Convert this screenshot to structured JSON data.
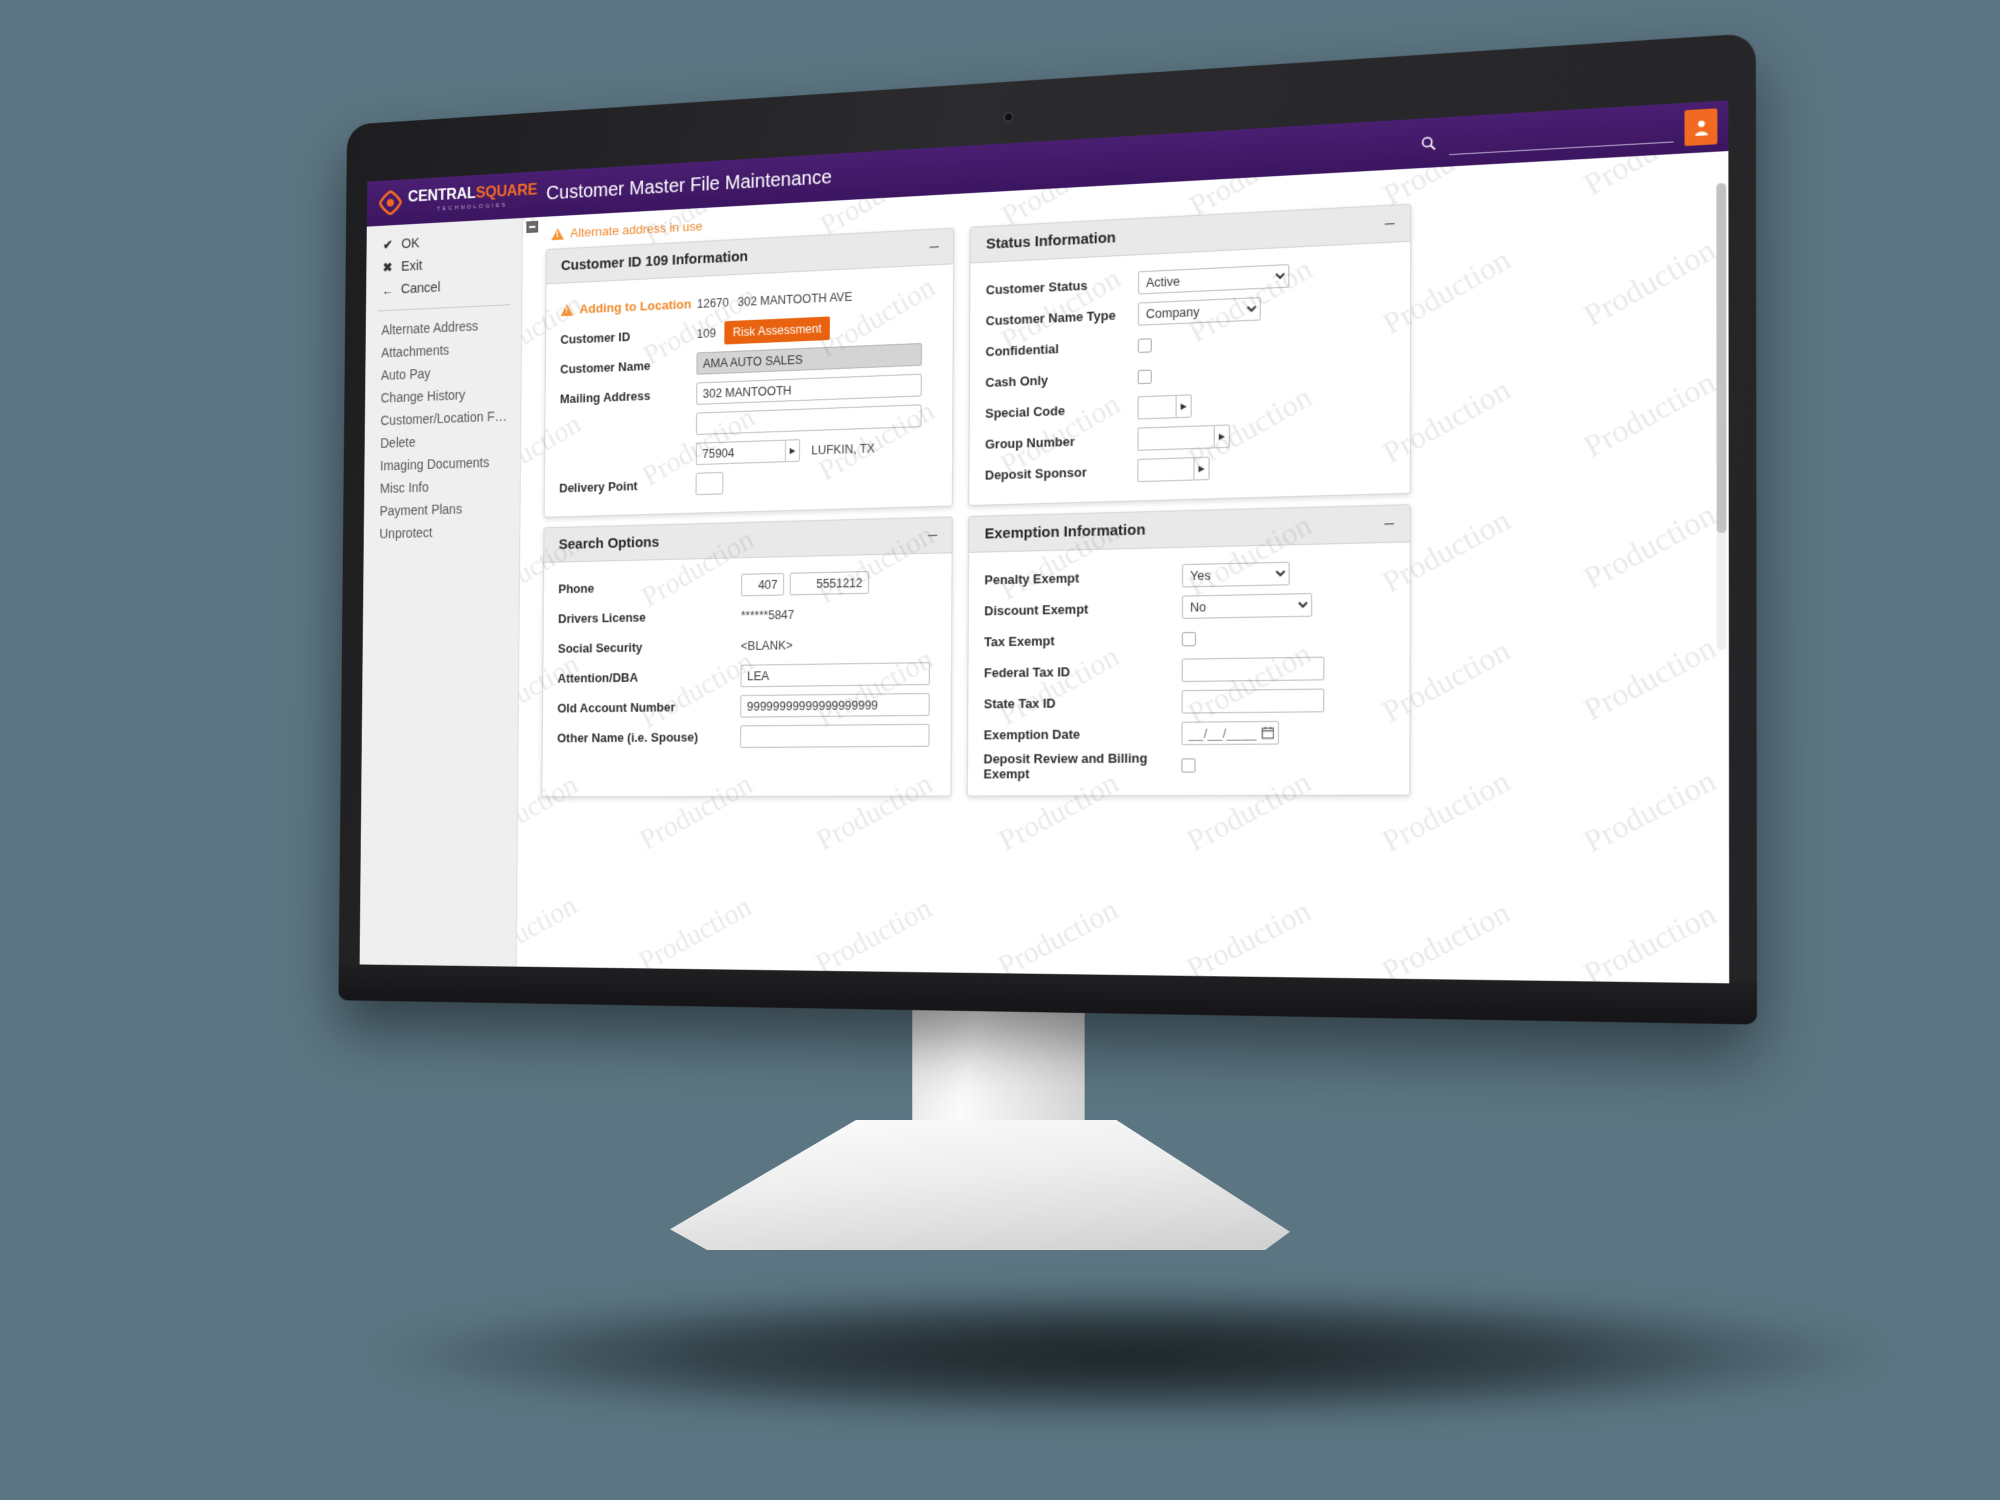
{
  "header": {
    "brand_primary": "CENTRAL",
    "brand_secondary": "SQUARE",
    "brand_tagline": "TECHNOLOGIES",
    "app_title": "Customer Master File Maintenance",
    "search_value": "",
    "search_placeholder": ""
  },
  "sidebar": {
    "actions": [
      {
        "label": "OK",
        "glyph": "✔"
      },
      {
        "label": "Exit",
        "glyph": "✖"
      },
      {
        "label": "Cancel",
        "glyph": "←"
      }
    ],
    "items": [
      {
        "label": "Alternate Address"
      },
      {
        "label": "Attachments"
      },
      {
        "label": "Auto Pay"
      },
      {
        "label": "Change History"
      },
      {
        "label": "Customer/Location Functio..."
      },
      {
        "label": "Delete"
      },
      {
        "label": "Imaging Documents"
      },
      {
        "label": "Misc Info"
      },
      {
        "label": "Payment Plans"
      },
      {
        "label": "Unprotect"
      }
    ]
  },
  "alert": {
    "message": "Alternate address in use"
  },
  "panels": {
    "customer_info": {
      "title": "Customer ID 109 Information",
      "collapse_glyph": "–",
      "adding_label": "Adding to Location",
      "location_id": "12670",
      "location_address": "302 MANTOOTH AVE",
      "customer_id_label": "Customer ID",
      "customer_id_value": "109",
      "risk_button": "Risk Assessment",
      "customer_name_label": "Customer Name",
      "customer_name_value": "AMA AUTO SALES",
      "mailing_address_label": "Mailing Address",
      "mailing_address_line1": "302 MANTOOTH",
      "mailing_address_line2": "",
      "zip_value": "75904",
      "city_state": "LUFKIN, TX",
      "delivery_point_label": "Delivery Point",
      "delivery_point_value": ""
    },
    "status_info": {
      "title": "Status Information",
      "collapse_glyph": "–",
      "customer_status_label": "Customer Status",
      "customer_status_value": "Active",
      "customer_status_options": [
        "Active"
      ],
      "name_type_label": "Customer Name Type",
      "name_type_value": "Company",
      "name_type_options": [
        "Company"
      ],
      "confidential_label": "Confidential",
      "confidential_checked": false,
      "cash_only_label": "Cash Only",
      "cash_only_checked": false,
      "special_code_label": "Special Code",
      "special_code_value": "",
      "group_number_label": "Group Number",
      "group_number_value": "",
      "deposit_sponsor_label": "Deposit Sponsor",
      "deposit_sponsor_value": ""
    },
    "search_options": {
      "title": "Search Options",
      "collapse_glyph": "–",
      "phone_label": "Phone",
      "phone_area": "407",
      "phone_number": "5551212",
      "drivers_license_label": "Drivers License",
      "drivers_license_value": "******5847",
      "social_security_label": "Social Security",
      "social_security_value": "<BLANK>",
      "attention_label": "Attention/DBA",
      "attention_value": "LEA",
      "old_account_label": "Old Account Number",
      "old_account_value": "99999999999999999999",
      "other_name_label": "Other Name (i.e. Spouse)",
      "other_name_value": ""
    },
    "exemption_info": {
      "title": "Exemption Information",
      "collapse_glyph": "–",
      "penalty_exempt_label": "Penalty Exempt",
      "penalty_exempt_value": "Yes",
      "penalty_exempt_options": [
        "Yes",
        "No"
      ],
      "discount_exempt_label": "Discount Exempt",
      "discount_exempt_value": "No",
      "discount_exempt_options": [
        "Yes",
        "No"
      ],
      "tax_exempt_label": "Tax Exempt",
      "tax_exempt_checked": false,
      "federal_tax_label": "Federal Tax ID",
      "federal_tax_value": "",
      "state_tax_label": "State Tax ID",
      "state_tax_value": "",
      "exemption_date_label": "Exemption Date",
      "exemption_date_value": "__/__/____",
      "deposit_review_label": "Deposit Review and Billing Exempt",
      "deposit_review_checked": false
    }
  },
  "watermark": {
    "text": "Production"
  },
  "colors": {
    "brand_purple": "#3b1560",
    "brand_orange": "#f26a21",
    "accent_orange": "#e8620f",
    "warning_orange": "#f08a2a"
  }
}
